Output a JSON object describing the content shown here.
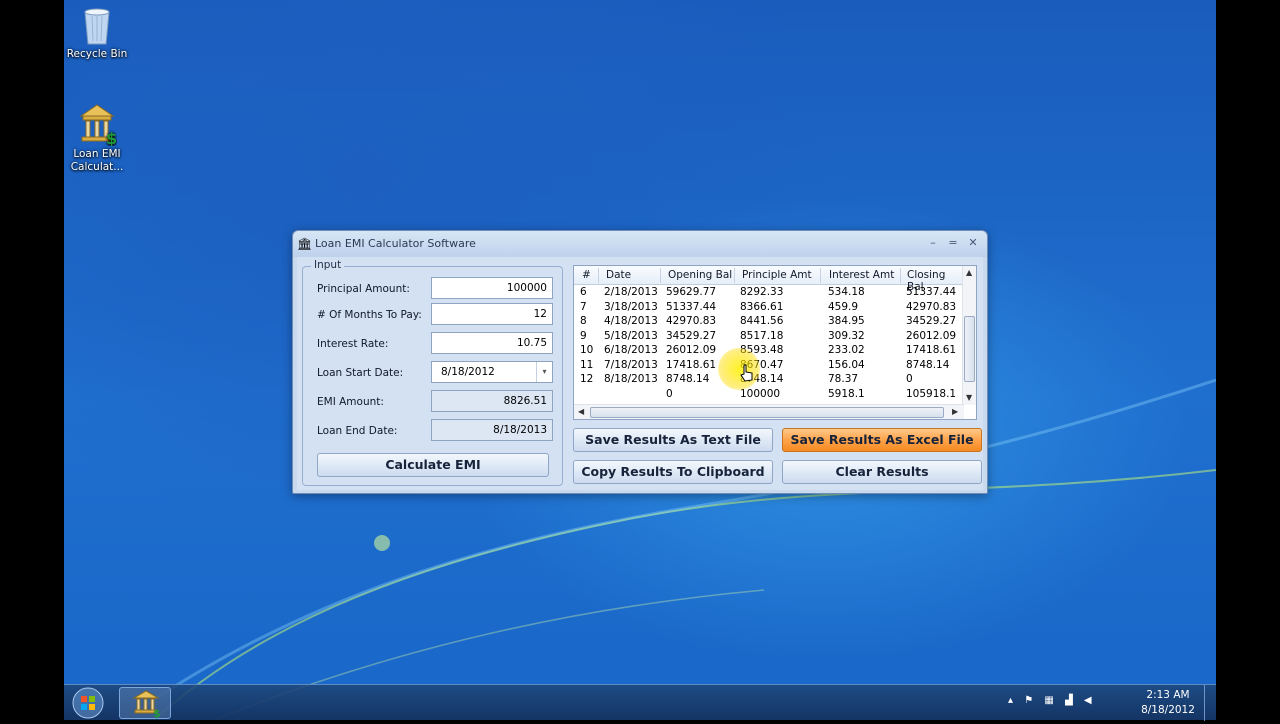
{
  "desktop": {
    "icons": [
      {
        "label": "Recycle Bin",
        "icon": "recycle-bin-icon"
      },
      {
        "label": "Loan EMI Calculat...",
        "icon": "bank-dollar-icon"
      }
    ]
  },
  "window": {
    "title": "Loan EMI Calculator Software",
    "controls": {
      "minimize": "–",
      "maximize": "=",
      "close": "✕"
    }
  },
  "input": {
    "group_title": "Input",
    "principal_label": "Principal Amount:",
    "principal_value": "100000",
    "months_label": "# Of Months To Pay:",
    "months_value": "12",
    "rate_label": "Interest Rate:",
    "rate_value": "10.75",
    "start_label": "Loan Start Date:",
    "start_value": "8/18/2012",
    "emi_label": "EMI Amount:",
    "emi_value": "8826.51",
    "end_label": "Loan End Date:",
    "end_value": "8/18/2013",
    "calculate_label": "Calculate EMI"
  },
  "table": {
    "headers": [
      "#",
      "Date",
      "Opening Bal",
      "Principle Amt",
      "Interest Amt",
      "Closing Bal"
    ],
    "rows": [
      [
        "6",
        "2/18/2013",
        "59629.77",
        "8292.33",
        "534.18",
        "51337.44"
      ],
      [
        "7",
        "3/18/2013",
        "51337.44",
        "8366.61",
        "459.9",
        "42970.83"
      ],
      [
        "8",
        "4/18/2013",
        "42970.83",
        "8441.56",
        "384.95",
        "34529.27"
      ],
      [
        "9",
        "5/18/2013",
        "34529.27",
        "8517.18",
        "309.32",
        "26012.09"
      ],
      [
        "10",
        "6/18/2013",
        "26012.09",
        "8593.48",
        "233.02",
        "17418.61"
      ],
      [
        "11",
        "7/18/2013",
        "17418.61",
        "8670.47",
        "156.04",
        "8748.14"
      ],
      [
        "12",
        "8/18/2013",
        "8748.14",
        "8748.14",
        "78.37",
        "0"
      ],
      [
        "",
        "",
        "0",
        "100000",
        "5918.1",
        "105918.1"
      ]
    ]
  },
  "buttons": {
    "save_text": "Save Results As Text File",
    "save_excel": "Save Results As Excel File",
    "copy": "Copy Results To Clipboard",
    "clear": "Clear Results"
  },
  "taskbar": {
    "time": "2:13 AM",
    "date": "8/18/2012"
  },
  "colors": {
    "accent_orange": "#f58a22",
    "desktop_blue": "#1f6fcf"
  }
}
